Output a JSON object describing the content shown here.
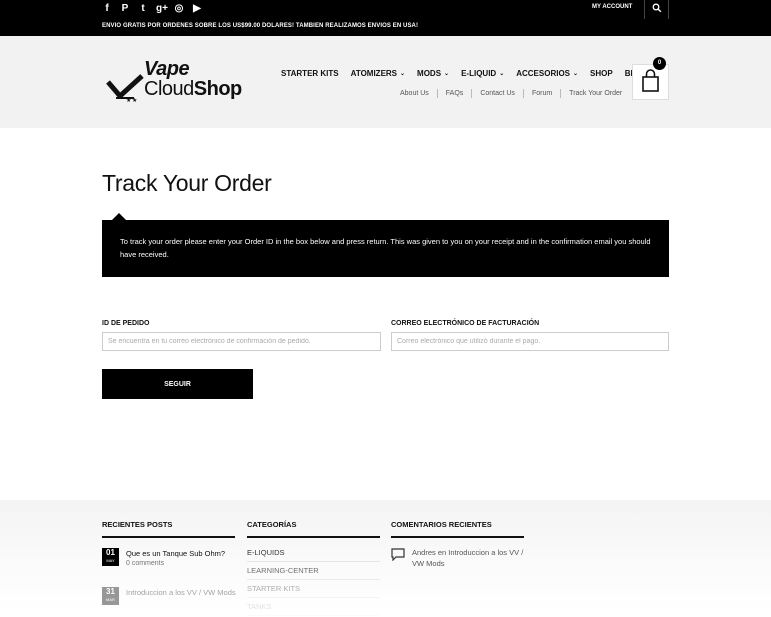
{
  "topbar": {
    "social_icons": [
      "facebook-icon",
      "pinterest-icon",
      "twitter-icon",
      "google-plus-icon",
      "instagram-icon",
      "youtube-icon"
    ],
    "social_glyphs": [
      "f",
      "P",
      "t",
      "g+",
      "◎",
      "▶"
    ],
    "promo": "ENVIO GRATIS POR ORDENES SOBRE LOS US$99.00 DOLARES! TAMBIEN REALIZAMOS ENVIOS EN USA!",
    "account": "MY ACCOUNT"
  },
  "logo": {
    "line1": "Vape",
    "line2a": "Cloud",
    "line2b": "Shop"
  },
  "nav": {
    "items": [
      {
        "label": "STARTER KITS",
        "dropdown": false
      },
      {
        "label": "ATOMIZERS",
        "dropdown": true
      },
      {
        "label": "MODS",
        "dropdown": true
      },
      {
        "label": "E-LIQUID",
        "dropdown": true
      },
      {
        "label": "ACCESORIOS",
        "dropdown": true
      },
      {
        "label": "SHOP",
        "dropdown": false
      },
      {
        "label": "BLOG",
        "dropdown": false
      }
    ],
    "sub": [
      "About Us",
      "FAQs",
      "Contact Us",
      "Forum",
      "Track Your Order"
    ]
  },
  "cart": {
    "count": "0"
  },
  "main": {
    "title": "Track Your Order",
    "notice": "To track your order please enter your Order ID in the box below and press return. This was given to you on your receipt and in the confirmation email you should have received.",
    "order_label": "ID DE PEDIDO",
    "order_placeholder": "Se encuentra en tu correo electrónico de confirmación de pedido.",
    "email_label": "CORREO ELECTRÓNICO DE FACTURACIÓN",
    "email_placeholder": "Correo electrónico que utilizó durante el pago.",
    "submit": "SEGUIR"
  },
  "footer": {
    "recent_posts_title": "RECIENTES POSTS",
    "posts": [
      {
        "day": "01",
        "month": "MAY",
        "title": "Que es un Tanque Sub Ohm?",
        "meta": "0 comments"
      },
      {
        "day": "31",
        "month": "MAR",
        "title": "Introduccion a los VV / VW Mods",
        "meta": ""
      }
    ],
    "categories_title": "CATEGORÍAS",
    "categories": [
      "E-LIQUIDS",
      "LEARNING-CENTER",
      "STARTER KITS",
      "TANKS"
    ],
    "comments_title": "COMENTARIOS RECIENTES",
    "comment": "Andres en Introduccion a los VV / VW Mods"
  }
}
